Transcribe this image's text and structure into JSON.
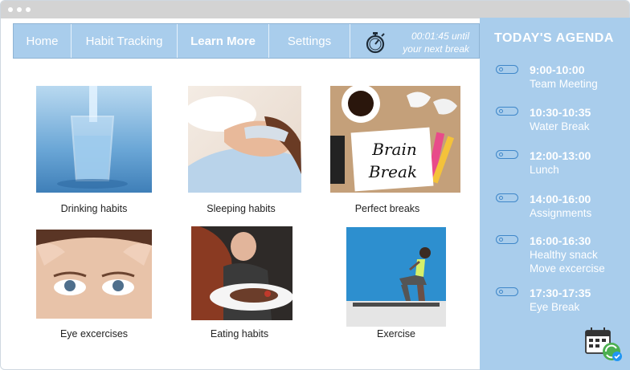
{
  "window": {
    "dots": 3
  },
  "nav": {
    "items": [
      "Home",
      "Habit Tracking",
      "Learn More",
      "Settings"
    ],
    "active": "Learn More",
    "timer_line1": "00:01:45 until",
    "timer_line2": "your next break"
  },
  "cards": [
    {
      "caption": "Drinking habits"
    },
    {
      "caption": "Sleeping habits"
    },
    {
      "caption": "Perfect breaks",
      "note_line1": "Brain",
      "note_line2": "Break"
    },
    {
      "caption": "Eye excercises"
    },
    {
      "caption": "Eating habits"
    },
    {
      "caption": "Exercise"
    }
  ],
  "agenda": {
    "title": "TODAY'S AGENDA",
    "items": [
      {
        "time": "9:00-10:00",
        "desc": "Team Meeting",
        "desc2": ""
      },
      {
        "time": "10:30-10:35",
        "desc": "Water Break",
        "desc2": ""
      },
      {
        "time": "12:00-13:00",
        "desc": "Lunch",
        "desc2": ""
      },
      {
        "time": "14:00-16:00",
        "desc": "Assignments",
        "desc2": ""
      },
      {
        "time": "16:00-16:30",
        "desc": "Healthy snack",
        "desc2": "Move excercise"
      },
      {
        "time": "17:30-17:35",
        "desc": "Eye Break",
        "desc2": ""
      }
    ]
  },
  "colors": {
    "accent": "#a9cdec",
    "toggle": "#3f87c9",
    "titlebar": "#d3d3d3"
  },
  "icons": [
    "stopwatch-icon",
    "calendar-sync-icon"
  ]
}
